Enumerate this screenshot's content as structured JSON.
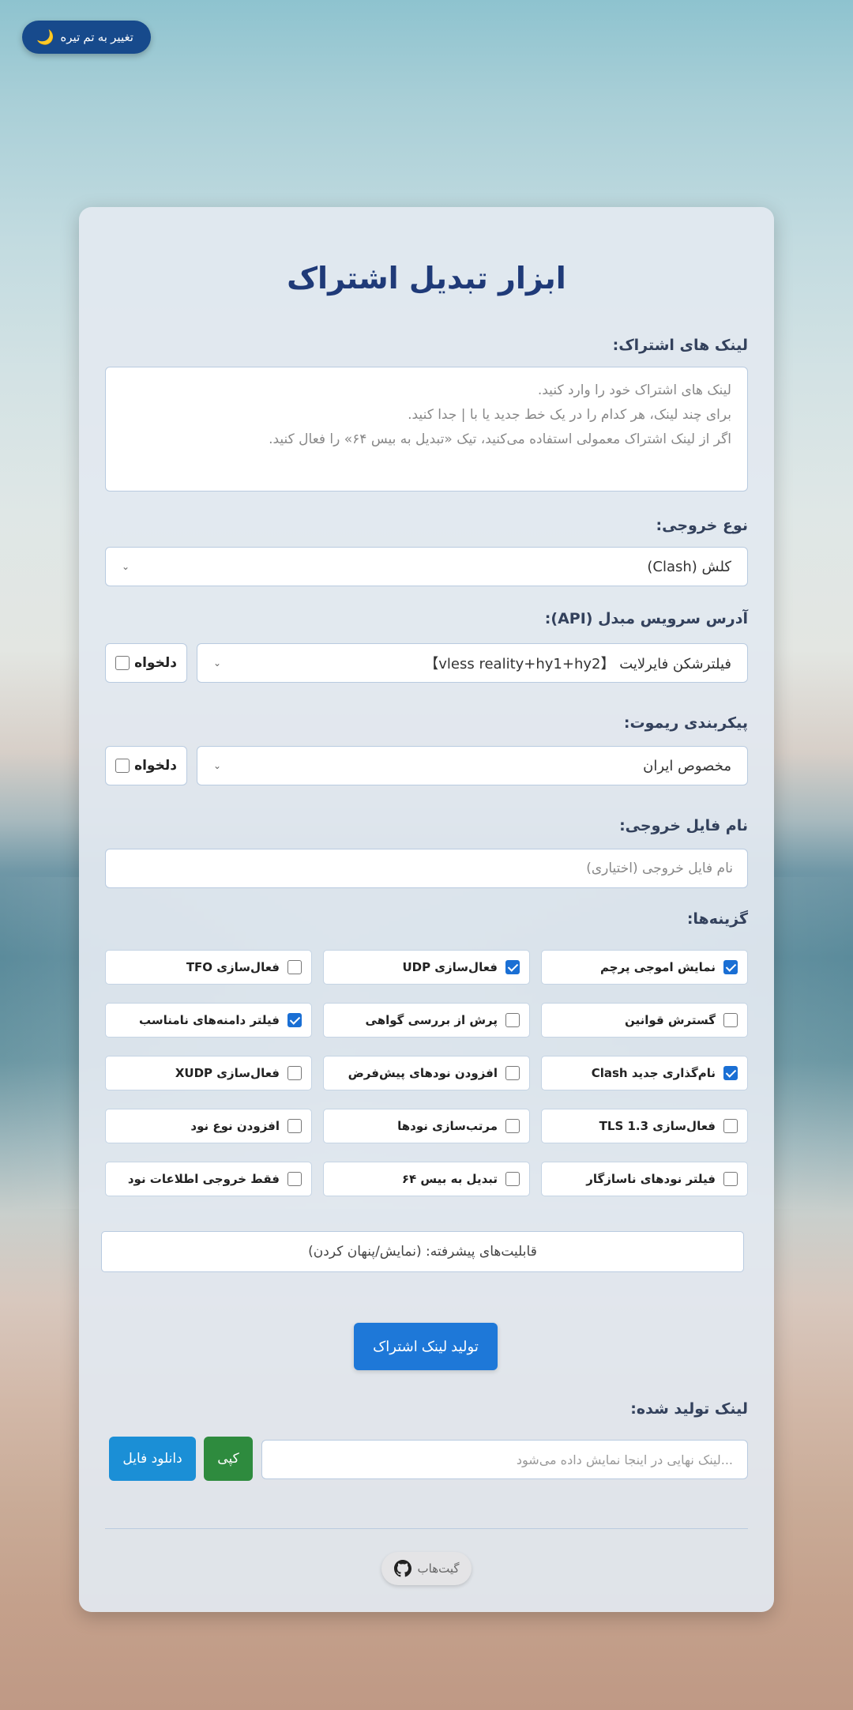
{
  "theme_toggle": {
    "label": "تغییر به تم تیره",
    "icon": "moon-icon"
  },
  "title": "ابزار تبدیل اشتراک",
  "subscription": {
    "label": "لینک های اشتراک:",
    "placeholder_lines": [
      "لینک های اشتراک خود را وارد کنید.",
      "برای چند لینک، هر کدام را در یک خط جدید یا با | جدا کنید.",
      "اگر از لینک اشتراک معمولی استفاده می‌کنید، تیک «تبدیل به بیس ۶۴» را فعال کنید."
    ]
  },
  "output_type": {
    "label": "نوع خروجی:",
    "value": "کلش (Clash)"
  },
  "api": {
    "label": "آدرس سرویس مبدل (API):",
    "value": "فیلترشکن فایرلایت 【vless reality+hy1+hy2】",
    "custom_label": "دلخواه"
  },
  "remote": {
    "label": "پیکربندی ریموت:",
    "value": "مخصوص ایران",
    "custom_label": "دلخواه"
  },
  "filename": {
    "label": "نام فایل خروجی:",
    "placeholder": "نام فایل خروجی (اختیاری)"
  },
  "options": {
    "label": "گزینه‌ها:",
    "items": [
      {
        "label": "نمایش اموجی پرچم",
        "checked": true
      },
      {
        "label": "فعال‌سازی UDP",
        "checked": true
      },
      {
        "label": "فعال‌سازی TFO",
        "checked": false
      },
      {
        "label": "گسترش قوانین",
        "checked": false
      },
      {
        "label": "پرش از بررسی گواهی",
        "checked": false
      },
      {
        "label": "فیلتر دامنه‌های نامناسب",
        "checked": true
      },
      {
        "label": "نام‌گذاری جدید Clash",
        "checked": true
      },
      {
        "label": "افزودن نودهای پیش‌فرض",
        "checked": false
      },
      {
        "label": "فعال‌سازی XUDP",
        "checked": false
      },
      {
        "label": "فعال‌سازی TLS 1.3",
        "checked": false
      },
      {
        "label": "مرتب‌سازی نودها",
        "checked": false
      },
      {
        "label": "افزودن نوع نود",
        "checked": false
      },
      {
        "label": "فیلتر نودهای ناسازگار",
        "checked": false
      },
      {
        "label": "تبدیل به بیس ۶۴",
        "checked": false
      },
      {
        "label": "فقط خروجی اطلاعات نود",
        "checked": false
      }
    ]
  },
  "advanced": {
    "label": "قابلیت‌های پیشرفته: (نمایش/پنهان کردن)"
  },
  "generate": {
    "label": "تولید لینک اشتراک"
  },
  "result": {
    "label": "لینک تولید شده:",
    "placeholder": "...لینک نهایی در اینجا نمایش داده می‌شود",
    "copy_label": "کپی",
    "download_label": "دانلود فایل"
  },
  "footer": {
    "github_label": "گیت‌هاب"
  },
  "colors": {
    "primary": "#1e78d8",
    "copy": "#2e8b3e",
    "title": "#1f3a78",
    "theme_btn": "#174a8c"
  }
}
